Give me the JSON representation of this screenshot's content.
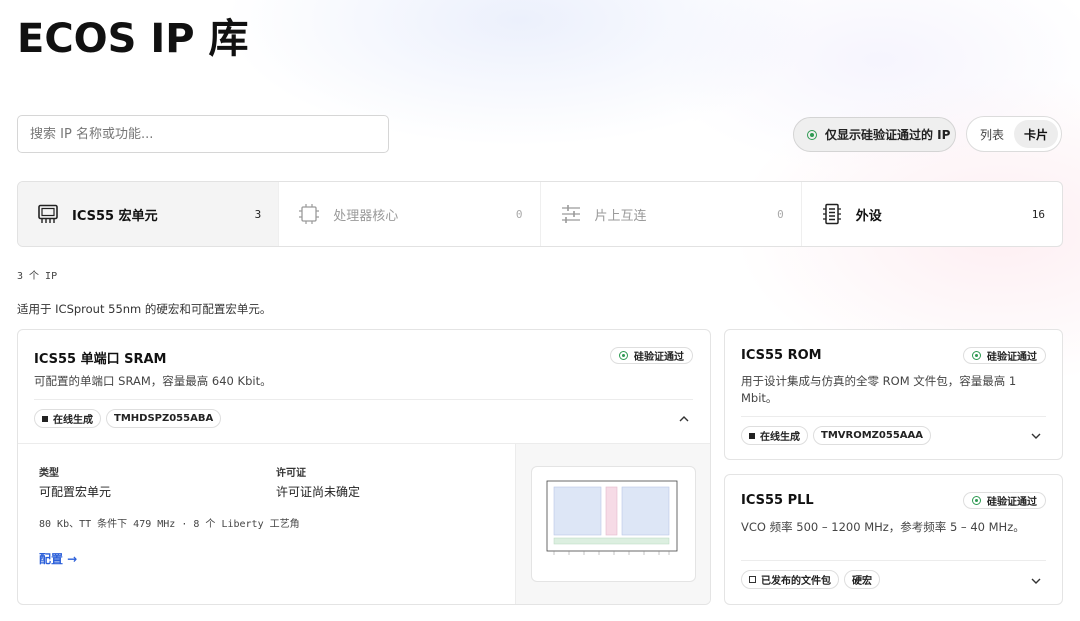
{
  "header": {
    "title": "ECOS IP 库"
  },
  "search": {
    "placeholder": "搜索 IP 名称或功能..."
  },
  "filter": {
    "verified_only_label": "仅显示硅验证通过的 IP"
  },
  "view_switch": {
    "list_label": "列表",
    "card_label": "卡片",
    "selected": "卡片"
  },
  "categories": [
    {
      "label": "ICS55 宏单元",
      "count": "3",
      "icon": "chip-icon",
      "active": true
    },
    {
      "label": "处理器核心",
      "count": "0",
      "icon": "cpu-icon",
      "active": false
    },
    {
      "label": "片上互连",
      "count": "0",
      "icon": "sliders-icon",
      "active": false
    },
    {
      "label": "外设",
      "count": "16",
      "icon": "peripheral-icon",
      "active": false
    }
  ],
  "results": {
    "count_label": "3 个 IP",
    "category_description": "适用于 ICSprout 55nm 的硬宏和可配置宏单元。"
  },
  "cards": {
    "sram": {
      "title": "ICS55 单端口 SRAM",
      "badge": "硅验证通过",
      "description": "可配置的单端口 SRAM，容量最高 640 Kbit。",
      "tags": [
        "在线生成",
        "TMHDSPZ055ABA"
      ],
      "expanded": true,
      "detail": {
        "type_label": "类型",
        "type_value": "可配置宏单元",
        "license_label": "许可证",
        "license_value": "许可证尚未确定",
        "spec": "80 Kb、TT 条件下 479 MHz · 8 个 Liberty 工艺角",
        "configure_link": "配置 →"
      }
    },
    "rom": {
      "title": "ICS55 ROM",
      "badge": "硅验证通过",
      "description": "用于设计集成与仿真的全零 ROM 文件包，容量最高 1 Mbit。",
      "tags": [
        "在线生成",
        "TMVROMZ055AAA"
      ]
    },
    "pll": {
      "title": "ICS55 PLL",
      "badge": "硅验证通过",
      "description": "VCO 频率 500 – 1200 MHz，参考频率 5 – 40 MHz。",
      "tags": [
        "已发布的文件包",
        "硬宏"
      ]
    }
  },
  "colors": {
    "link": "#2b5fd9",
    "verified": "#2e9a52",
    "active_category_bg": "#f4f4f4"
  }
}
